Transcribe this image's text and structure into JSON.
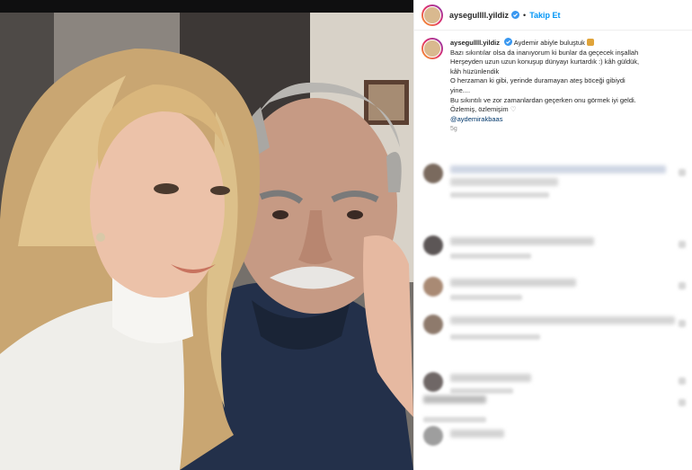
{
  "post": {
    "username": "aysegullll.yildiz",
    "dot": "•",
    "follow_label": "Takip Et",
    "caption": {
      "line1": "Aydemir abiyle buluştuk",
      "line2": "Bazı sıkıntılar olsa da inanıyorum ki bunlar da geçecek inşallah",
      "line3": "Herşeyden uzun uzun konuşup dünyayı kurtardık :) kâh güldük,",
      "line4": "kâh hüzünlendik",
      "line5": "O herzaman ki gibi, yerinde duramayan ateş böceği gibiydi",
      "line6": "yine....",
      "line7": "Bu sıkıntılı ve zor zamanlardan geçerken onu görmek iyi geldi.",
      "line8": "Özlemiş, özlemişim",
      "heart": "♡",
      "mention": "@aydemirakbaas",
      "ago": "5g"
    }
  },
  "colors": {
    "link": "#0095f6",
    "mention": "#00376b",
    "muted": "#8e8e8e",
    "text": "#262626"
  },
  "icons": [
    "verified-badge-icon",
    "smile-emoji-icon",
    "heart-outline-icon"
  ]
}
